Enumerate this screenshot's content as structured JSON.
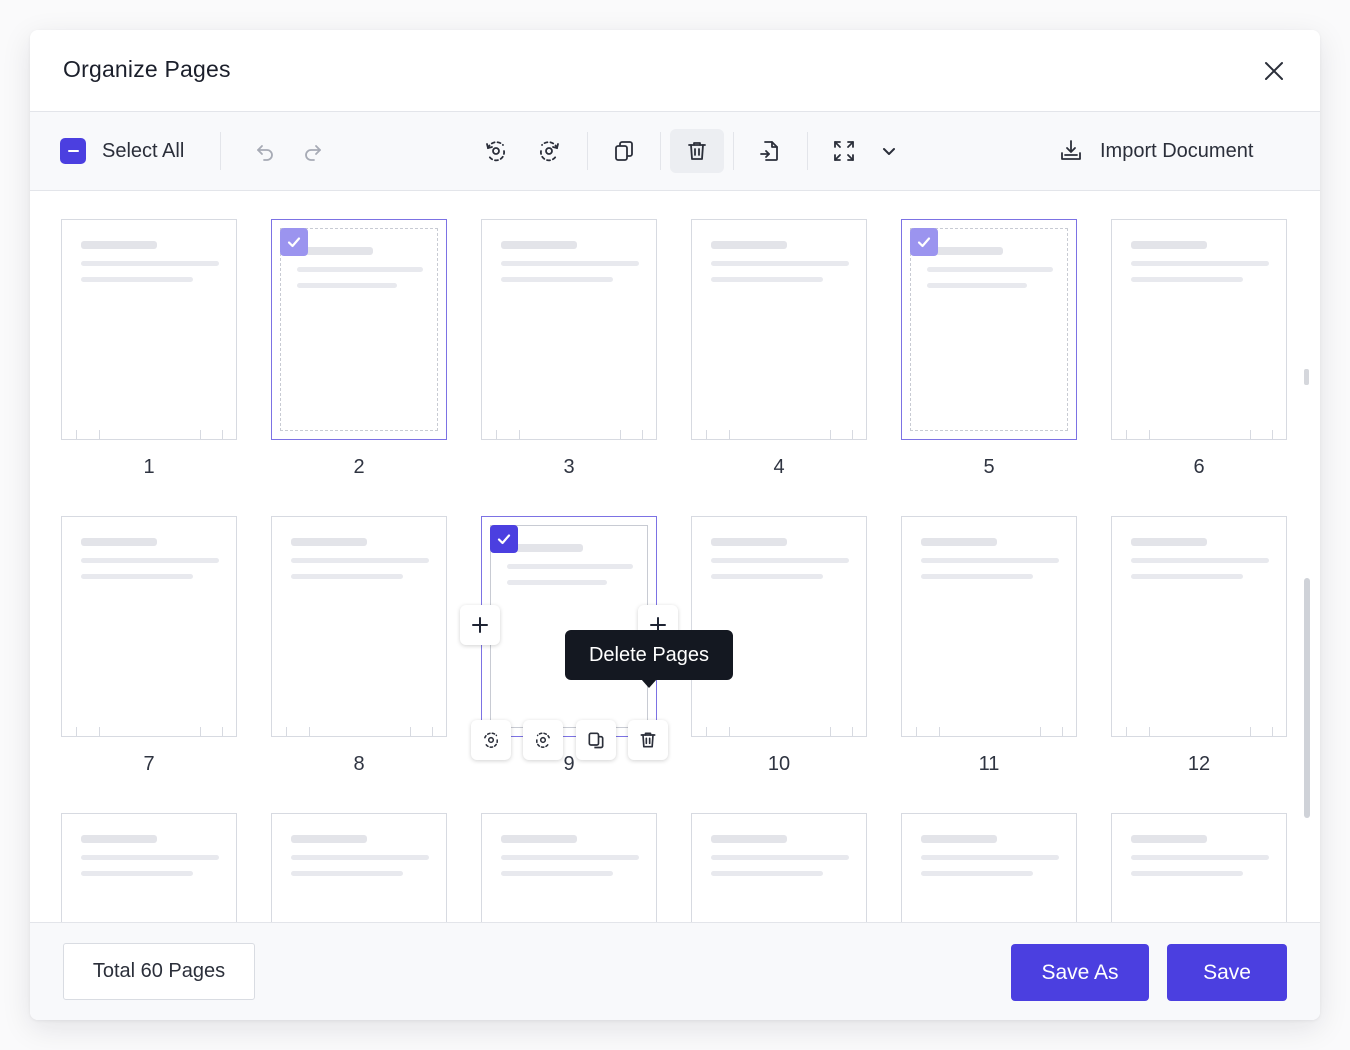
{
  "dialog": {
    "title": "Organize Pages"
  },
  "toolbar": {
    "select_all_label": "Select All",
    "import_label": "Import Document",
    "icons": [
      "undo-icon",
      "redo-icon",
      "rotate-left-icon",
      "rotate-right-icon",
      "duplicate-icon",
      "trash-icon",
      "extract-icon",
      "fit-page-icon",
      "chevron-down-icon",
      "import-icon"
    ]
  },
  "pages": [
    {
      "label": "1",
      "selected": false
    },
    {
      "label": "2",
      "selected": true
    },
    {
      "label": "3",
      "selected": false
    },
    {
      "label": "4",
      "selected": false
    },
    {
      "label": "5",
      "selected": true
    },
    {
      "label": "6",
      "selected": false
    },
    {
      "label": "7",
      "selected": false
    },
    {
      "label": "8",
      "selected": false
    },
    {
      "label": "9",
      "selected": true
    },
    {
      "label": "10",
      "selected": false
    },
    {
      "label": "11",
      "selected": false
    },
    {
      "label": "12",
      "selected": false
    }
  ],
  "tooltip": {
    "text": "Delete Pages"
  },
  "footer": {
    "total_label": "Total 60 Pages",
    "save_as_label": "Save As",
    "save_label": "Save"
  },
  "colors": {
    "accent": "#4b3fe0",
    "selected_border": "#7c72e4",
    "selected_check": "#9b94ef",
    "tooltip_bg": "#141821"
  }
}
